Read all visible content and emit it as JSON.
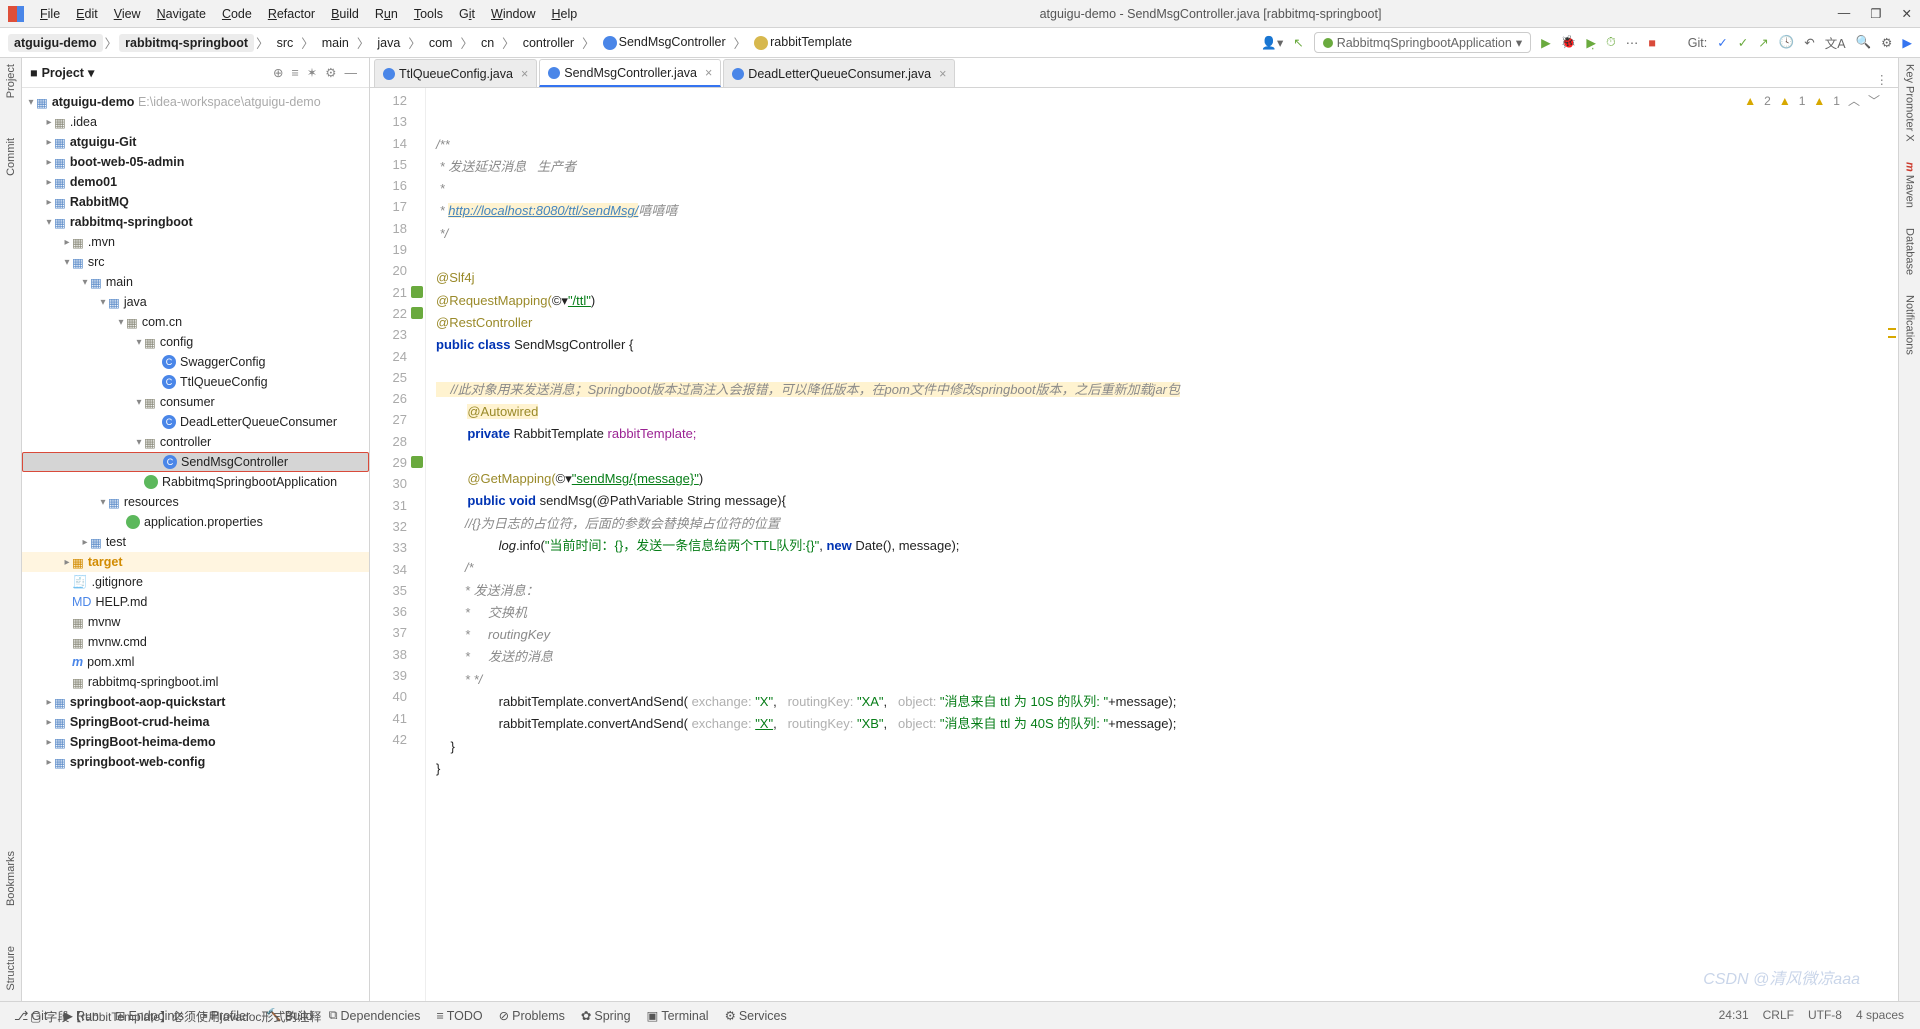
{
  "window": {
    "title": "atguigu-demo - SendMsgController.java [rabbitmq-springboot]"
  },
  "menu": [
    "File",
    "Edit",
    "View",
    "Navigate",
    "Code",
    "Refactor",
    "Build",
    "Run",
    "Tools",
    "Git",
    "Window",
    "Help"
  ],
  "breadcrumb": {
    "parts": [
      "atguigu-demo",
      "rabbitmq-springboot",
      "src",
      "main",
      "java",
      "com",
      "cn",
      "controller",
      "SendMsgController",
      "rabbitTemplate"
    ]
  },
  "runconfig": {
    "name": "RabbitmqSpringbootApplication"
  },
  "git_label": "Git:",
  "left_tabs": {
    "project": "Project",
    "commit": "Commit",
    "bookmarks": "Bookmarks",
    "structure": "Structure"
  },
  "right_tabs": {
    "key": "Key Promoter X",
    "maven": "Maven",
    "database": "Database",
    "notif": "Notifications"
  },
  "sidebar": {
    "title": "Project",
    "root": {
      "name": "atguigu-demo",
      "path": "E:\\idea-workspace\\atguigu-demo"
    },
    "items": [
      ".idea",
      "atguigu-Git",
      "boot-web-05-admin",
      "demo01",
      "RabbitMQ",
      "rabbitmq-springboot",
      ".mvn",
      "src",
      "main",
      "java",
      "com.cn",
      "config",
      "SwaggerConfig",
      "TtlQueueConfig",
      "consumer",
      "DeadLetterQueueConsumer",
      "controller",
      "SendMsgController",
      "RabbitmqSpringbootApplication",
      "resources",
      "application.properties",
      "test",
      "target",
      ".gitignore",
      "HELP.md",
      "mvnw",
      "mvnw.cmd",
      "pom.xml",
      "rabbitmq-springboot.iml",
      "springboot-aop-quickstart",
      "SpringBoot-crud-heima",
      "SpringBoot-heima-demo",
      "springboot-web-config"
    ]
  },
  "tabs": [
    {
      "label": "TtlQueueConfig.java",
      "active": false
    },
    {
      "label": "SendMsgController.java",
      "active": true
    },
    {
      "label": "DeadLetterQueueConsumer.java",
      "active": false
    }
  ],
  "inspections": {
    "err": "2",
    "warn": "1",
    "weak": "1"
  },
  "code": {
    "l13": "/**",
    "l14": " * 发送延迟消息   生产者",
    "l15": " *",
    "l16a": " * ",
    "l16b": "http://localhost:8080/ttl/sendMsg/",
    "l16c": "嘻嘻嘻",
    "l17": " */",
    "l19": "@Slf4j",
    "l20a": "@RequestMapping(",
    "l20b": "\"/ttl\"",
    "l20c": ")",
    "l21": "@RestController",
    "l22a": "public",
    "l22b": "class",
    "l22c": "SendMsgController {",
    "l24": "    //此对象用来发送消息；Springboot版本过高注入会报错，可以降低版本，在pom文件中修改springboot版本，之后重新加载jar包",
    "l25": "@Autowired",
    "l26a": "private",
    "l26b": "RabbitTemplate",
    "l26c": "rabbitTemplate;",
    "l28a": "@GetMapping(",
    "l28b": "\"sendMsg/{message}\"",
    "l28c": ")",
    "l29a": "public",
    "l29b": "void",
    "l29c": "sendMsg(@PathVariable String message){",
    "l30": "        //{}为日志的占位符，后面的参数会替换掉占位符的位置",
    "l31a": "log",
    "l31b": ".info(",
    "l31s": "\"当前时间：{}，发送一条信息给两个TTL队列:{}\"",
    "l31c": ", ",
    "l31n": "new",
    "l31d": " Date(), message);",
    "l32": "        /*",
    "l33": "        * 发送消息：",
    "l34": "        *     交换机",
    "l35": "        *     routingKey",
    "l36": "        *     发送的消息",
    "l37": "        * */",
    "l38a": "rabbitTemplate.convertAndSend(",
    "l38h1": " exchange: ",
    "l38s1": "\"X\"",
    "l38c1": ", ",
    "l38h2": " routingKey: ",
    "l38s2": "\"XA\"",
    "l38c2": ", ",
    "l38h3": " object: ",
    "l38s3": "\"消息来自 ttl 为 10S 的队列: \"",
    "l38e": "+message);",
    "l39a": "rabbitTemplate.convertAndSend(",
    "l39h1": " exchange: ",
    "l39s1": "\"X\"",
    "l39c1": ", ",
    "l39h2": " routingKey: ",
    "l39s2": "\"XB\"",
    "l39c2": ", ",
    "l39h3": " object: ",
    "l39s3": "\"消息来自 ttl 为 40S 的队列: \"",
    "l39e": "+message);",
    "l40": "    }",
    "l41": "}"
  },
  "bottom_tools": [
    "Git",
    "Run",
    "Endpoints",
    "Profiler",
    "Build",
    "Dependencies",
    "TODO",
    "Problems",
    "Spring",
    "Terminal",
    "Services"
  ],
  "status": {
    "msg": "字段【rabbitTemplate】必须使用javadoc形式的注释",
    "pos": "24:31",
    "eol": "CRLF",
    "enc": "UTF-8",
    "sp": "4 spaces"
  },
  "watermark": "CSDN @清风微凉aaa"
}
